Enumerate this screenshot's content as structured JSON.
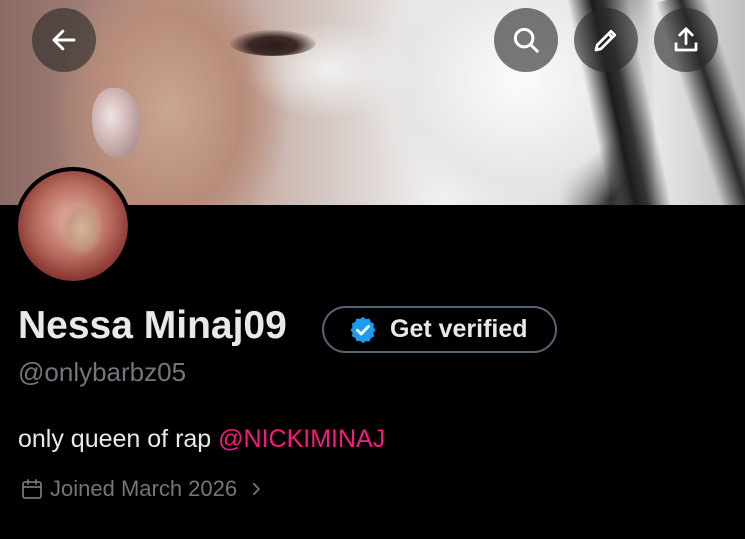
{
  "header": {
    "back_icon": "arrow-left-icon",
    "search_icon": "search-icon",
    "edit_icon": "pencil-icon",
    "share_icon": "upload-icon"
  },
  "profile": {
    "display_name": "Nessa Minaj09",
    "verify_label": "Get verified",
    "handle": "@onlybarbz05",
    "bio_text": "only queen of rap ",
    "bio_mention": "@NICKIMINAJ",
    "joined": "Joined March 2026"
  },
  "colors": {
    "background": "#000000",
    "text_primary": "#e7e9ea",
    "text_secondary": "#71767b",
    "mention": "#f91880",
    "verified_badge": "#1d9bf0"
  }
}
